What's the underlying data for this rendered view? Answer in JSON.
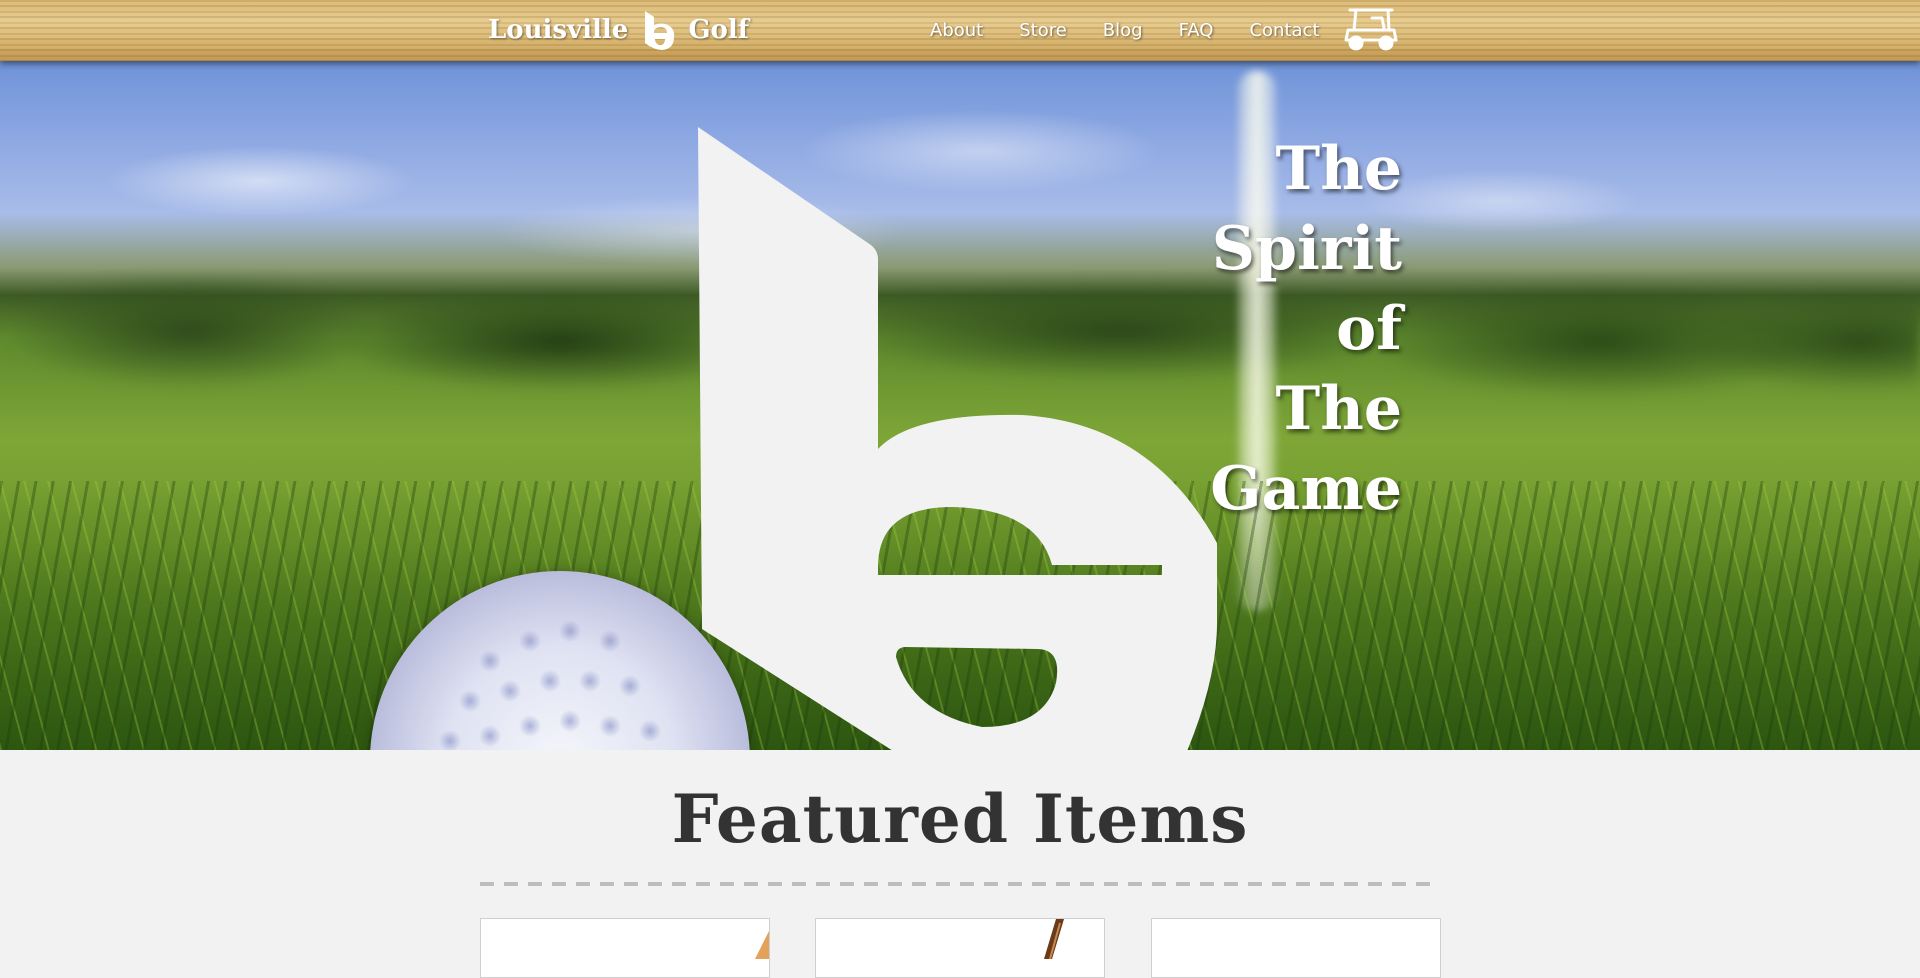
{
  "header": {
    "logo_left": "Louisville",
    "logo_right": "Golf",
    "nav": [
      "About",
      "Store",
      "Blog",
      "FAQ",
      "Contact"
    ]
  },
  "icons": {
    "logo_mark": "lg-logo-icon",
    "cart": "golf-cart-icon"
  },
  "hero": {
    "tagline": [
      "The",
      "Spirit",
      "of",
      "The",
      "Game"
    ]
  },
  "featured": {
    "title": "Featured Items"
  },
  "colors": {
    "background": "#f2f2f2",
    "title_text": "#333333",
    "logo_fill": "#f2f2f2",
    "nav_text": "#ffffff"
  }
}
